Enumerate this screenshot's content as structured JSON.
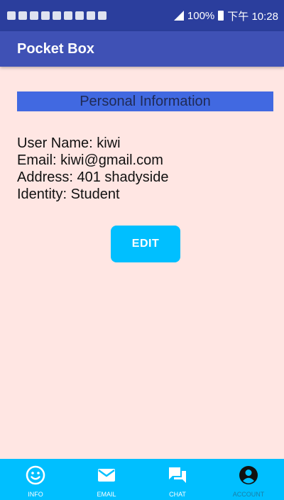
{
  "status_bar": {
    "time": "下午 10:28",
    "battery": "100%"
  },
  "app_bar": {
    "title": "Pocket Box"
  },
  "section": {
    "title": "Personal Information"
  },
  "profile": {
    "user_name": "User Name: kiwi",
    "email": "Email: kiwi@gmail.com",
    "address": "Address: 401 shadyside",
    "identity": "Identity: Student"
  },
  "actions": {
    "edit_label": "EDIT"
  },
  "bottom_nav": {
    "items": [
      {
        "label": "INFO",
        "icon": "smiley-icon"
      },
      {
        "label": "EMAIL",
        "icon": "envelope-icon"
      },
      {
        "label": "CHAT",
        "icon": "chat-bubble-icon"
      },
      {
        "label": "ACCOUNT",
        "icon": "account-icon"
      }
    ],
    "active": "ACCOUNT"
  },
  "colors": {
    "status_bar": "#2b3e9d",
    "app_bar": "#3f51b5",
    "section_header": "#4169e1",
    "accent": "#00bfff",
    "background": "#ffe6e3"
  }
}
